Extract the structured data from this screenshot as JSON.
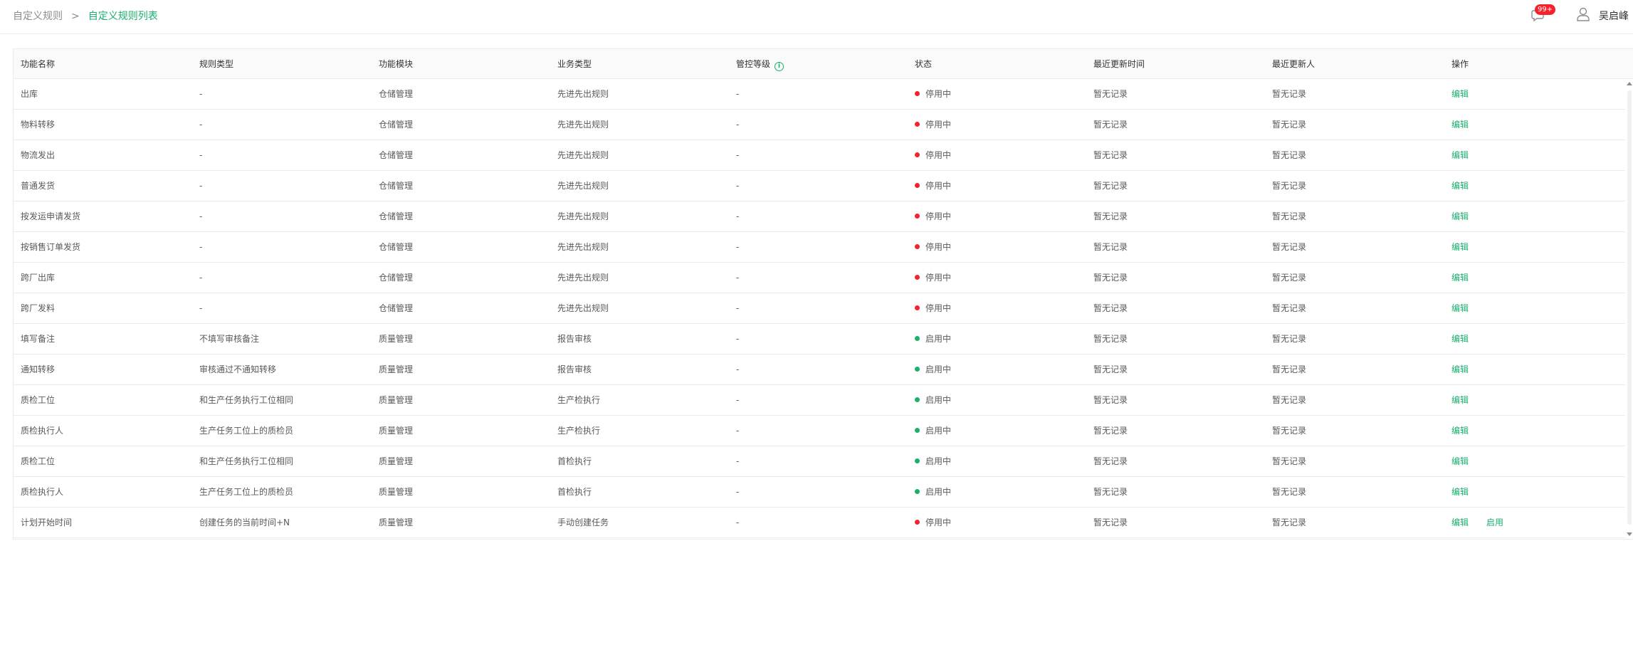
{
  "breadcrumb": {
    "root": "自定义规则",
    "separator": ">",
    "current": "自定义规则列表"
  },
  "header": {
    "notification_icon": "message-bell-icon",
    "notification_count": "99+",
    "user_icon": "user-icon",
    "user_name": "吴启峰"
  },
  "colors": {
    "accent": "#1aaf6d",
    "status_on": "#1aaf6d",
    "status_off": "#f5222d",
    "badge": "#f5222d"
  },
  "table": {
    "columns": [
      "功能名称",
      "规则类型",
      "功能模块",
      "业务类型",
      "管控等级",
      "状态",
      "最近更新时间",
      "最近更新人",
      "操作"
    ],
    "info_icon": "info-circle-icon",
    "rows": [
      {
        "name": "出库",
        "rule_type": "-",
        "module": "仓储管理",
        "business": "先进先出规则",
        "level": "-",
        "status": "停用中",
        "status_on": false,
        "updated_at": "暂无记录",
        "updated_by": "暂无记录",
        "actions": [
          "编辑"
        ]
      },
      {
        "name": "物料转移",
        "rule_type": "-",
        "module": "仓储管理",
        "business": "先进先出规则",
        "level": "-",
        "status": "停用中",
        "status_on": false,
        "updated_at": "暂无记录",
        "updated_by": "暂无记录",
        "actions": [
          "编辑"
        ]
      },
      {
        "name": "物流发出",
        "rule_type": "-",
        "module": "仓储管理",
        "business": "先进先出规则",
        "level": "-",
        "status": "停用中",
        "status_on": false,
        "updated_at": "暂无记录",
        "updated_by": "暂无记录",
        "actions": [
          "编辑"
        ]
      },
      {
        "name": "普通发货",
        "rule_type": "-",
        "module": "仓储管理",
        "business": "先进先出规则",
        "level": "-",
        "status": "停用中",
        "status_on": false,
        "updated_at": "暂无记录",
        "updated_by": "暂无记录",
        "actions": [
          "编辑"
        ]
      },
      {
        "name": "按发运申请发货",
        "rule_type": "-",
        "module": "仓储管理",
        "business": "先进先出规则",
        "level": "-",
        "status": "停用中",
        "status_on": false,
        "updated_at": "暂无记录",
        "updated_by": "暂无记录",
        "actions": [
          "编辑"
        ]
      },
      {
        "name": "按销售订单发货",
        "rule_type": "-",
        "module": "仓储管理",
        "business": "先进先出规则",
        "level": "-",
        "status": "停用中",
        "status_on": false,
        "updated_at": "暂无记录",
        "updated_by": "暂无记录",
        "actions": [
          "编辑"
        ]
      },
      {
        "name": "跨厂出库",
        "rule_type": "-",
        "module": "仓储管理",
        "business": "先进先出规则",
        "level": "-",
        "status": "停用中",
        "status_on": false,
        "updated_at": "暂无记录",
        "updated_by": "暂无记录",
        "actions": [
          "编辑"
        ]
      },
      {
        "name": "跨厂发料",
        "rule_type": "-",
        "module": "仓储管理",
        "business": "先进先出规则",
        "level": "-",
        "status": "停用中",
        "status_on": false,
        "updated_at": "暂无记录",
        "updated_by": "暂无记录",
        "actions": [
          "编辑"
        ]
      },
      {
        "name": "填写备注",
        "rule_type": "不填写审核备注",
        "module": "质量管理",
        "business": "报告审核",
        "level": "-",
        "status": "启用中",
        "status_on": true,
        "updated_at": "暂无记录",
        "updated_by": "暂无记录",
        "actions": [
          "编辑"
        ]
      },
      {
        "name": "通知转移",
        "rule_type": "审核通过不通知转移",
        "module": "质量管理",
        "business": "报告审核",
        "level": "-",
        "status": "启用中",
        "status_on": true,
        "updated_at": "暂无记录",
        "updated_by": "暂无记录",
        "actions": [
          "编辑"
        ]
      },
      {
        "name": "质检工位",
        "rule_type": "和生产任务执行工位相同",
        "module": "质量管理",
        "business": "生产检执行",
        "level": "-",
        "status": "启用中",
        "status_on": true,
        "updated_at": "暂无记录",
        "updated_by": "暂无记录",
        "actions": [
          "编辑"
        ]
      },
      {
        "name": "质检执行人",
        "rule_type": "生产任务工位上的质检员",
        "module": "质量管理",
        "business": "生产检执行",
        "level": "-",
        "status": "启用中",
        "status_on": true,
        "updated_at": "暂无记录",
        "updated_by": "暂无记录",
        "actions": [
          "编辑"
        ]
      },
      {
        "name": "质检工位",
        "rule_type": "和生产任务执行工位相同",
        "module": "质量管理",
        "business": "首检执行",
        "level": "-",
        "status": "启用中",
        "status_on": true,
        "updated_at": "暂无记录",
        "updated_by": "暂无记录",
        "actions": [
          "编辑"
        ]
      },
      {
        "name": "质检执行人",
        "rule_type": "生产任务工位上的质检员",
        "module": "质量管理",
        "business": "首检执行",
        "level": "-",
        "status": "启用中",
        "status_on": true,
        "updated_at": "暂无记录",
        "updated_by": "暂无记录",
        "actions": [
          "编辑"
        ]
      },
      {
        "name": "计划开始时间",
        "rule_type": "创建任务的当前时间+N",
        "module": "质量管理",
        "business": "手动创建任务",
        "level": "-",
        "status": "停用中",
        "status_on": false,
        "updated_at": "暂无记录",
        "updated_by": "暂无记录",
        "actions": [
          "编辑",
          "启用"
        ]
      }
    ]
  }
}
